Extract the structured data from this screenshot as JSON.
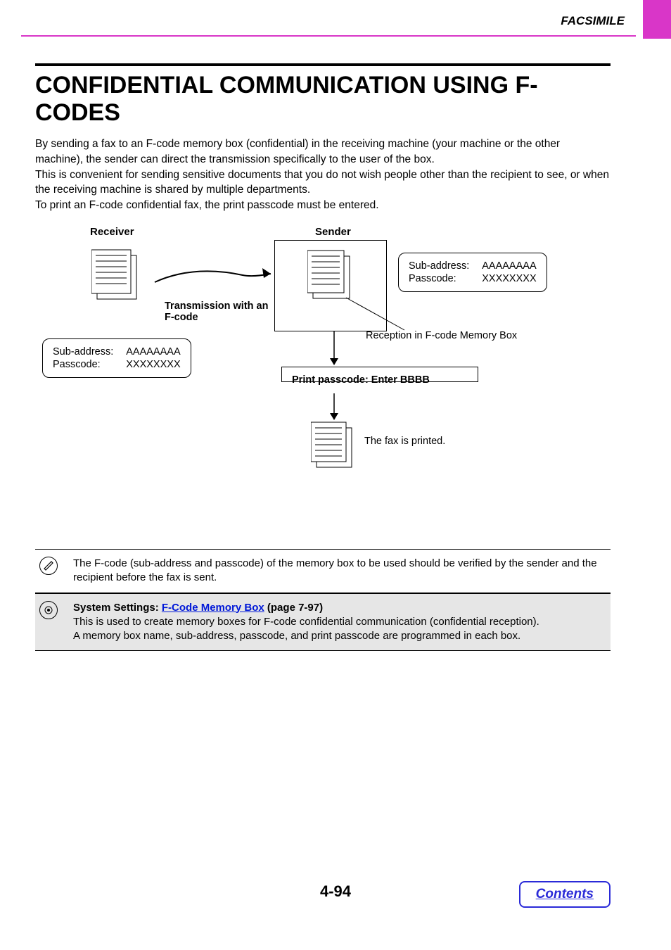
{
  "header": {
    "section": "FACSIMILE"
  },
  "title": "CONFIDENTIAL COMMUNICATION USING F-CODES",
  "paragraphs": {
    "p1": "By sending a fax to an F-code memory box (confidential) in the receiving machine (your machine or the other machine), the sender can direct the transmission specifically to the user of the box.",
    "p2": "This is convenient for sending sensitive documents that you do not wish people other than the recipient to see, or when the receiving machine is shared by multiple departments.",
    "p3": "To print an F-code confidential fax, the print passcode must be entered."
  },
  "diagram": {
    "receiver_label": "Receiver",
    "sender_label": "Sender",
    "transmission_label": "Transmission with an F-code",
    "sub_address_label": "Sub-address:",
    "passcode_label": "Passcode:",
    "sub_address_value": "AAAAAAAA",
    "passcode_value": "XXXXXXXX",
    "reception_label": "Reception in F-code Memory Box",
    "print_passcode_label": "Print passcode: Enter BBBB",
    "printed_label": "The fax is printed."
  },
  "notes": {
    "note1": "The F-code (sub-address and passcode) of the memory box to be used should be verified by the sender and the recipient before the fax is sent.",
    "note2_prefix": "System Settings: ",
    "note2_link": "F-Code Memory Box",
    "note2_page": " (page 7-97)",
    "note2_line1": "This is used to create memory boxes for F-code confidential communication (confidential reception).",
    "note2_line2": "A memory box name, sub-address, passcode, and print passcode are programmed in each box."
  },
  "footer": {
    "page_number": "4-94",
    "contents": "Contents"
  }
}
